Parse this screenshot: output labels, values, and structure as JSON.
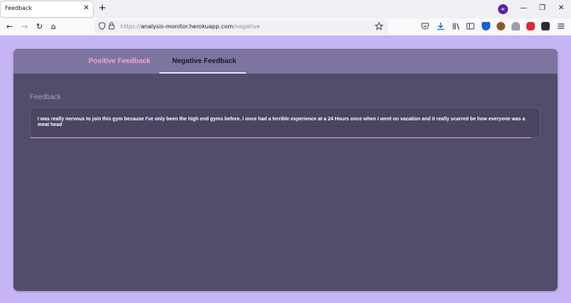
{
  "browser": {
    "tab_title": "Feedback",
    "tab_close": "✕",
    "new_tab": "+",
    "account_badge": "∞",
    "window_controls": {
      "minimize": "—",
      "restore": "❐",
      "close": "✕"
    },
    "nav": {
      "back": "←",
      "forward": "→",
      "reload": "↻",
      "home": "⌂"
    },
    "url": {
      "scheme": "https://",
      "domain": "analysis-monitor.herokuapp.com",
      "path": "/negative"
    },
    "icons": [
      "back-icon",
      "forward-icon",
      "reload-icon",
      "home-icon",
      "shield-icon",
      "lock-icon",
      "star-icon",
      "pocket-icon",
      "download-icon",
      "library-icon",
      "sidebar-icon",
      "menu-icon"
    ],
    "colors": {
      "chrome_bg": "#f0f0f4",
      "urlbar_bg": "#f0f0f4",
      "account": "#5b1fa6"
    }
  },
  "page": {
    "tabs": [
      {
        "label": "Positive Feedback",
        "active": false
      },
      {
        "label": "Negative Feedback",
        "active": true
      }
    ],
    "section_label": "Feedback",
    "feedback_text": "I was really nervous to join this gym because I've only been the high end gyms before. I once had a terrible experience at a 24 Hours once when I went on vacation and it really scarred be how everyone was a meat head",
    "colors": {
      "background": "#c6b4f4",
      "card": "#524d6c",
      "tab_bar": "#7e74a0",
      "positive_tab": "#f5a8c8",
      "negative_tab": "#1a1826",
      "accent_underline": "#e8a8c8"
    }
  }
}
